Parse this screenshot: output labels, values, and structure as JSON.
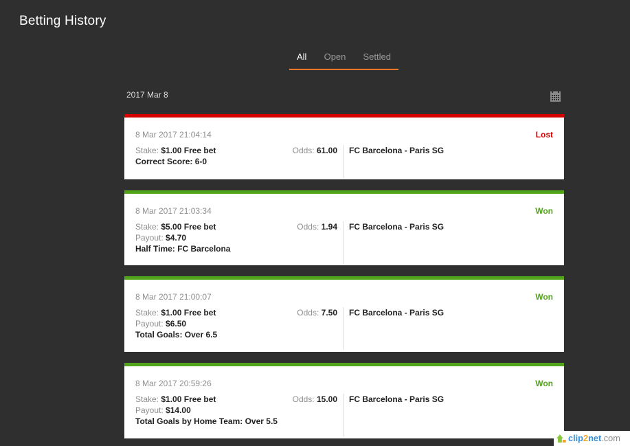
{
  "page": {
    "title": "Betting History"
  },
  "tabs": [
    {
      "label": "All",
      "active": true
    },
    {
      "label": "Open",
      "active": false
    },
    {
      "label": "Settled",
      "active": false
    }
  ],
  "date_group": {
    "label": "2017 Mar 8"
  },
  "labels": {
    "stake": "Stake:",
    "odds": "Odds:",
    "payout": "Payout:"
  },
  "bets": [
    {
      "time": "8 Mar 2017 21:04:14",
      "result": "Lost",
      "stake": "$1.00 Free bet",
      "odds": "61.00",
      "selection": "Correct Score: 6-0",
      "event": "FC Barcelona - Paris SG"
    },
    {
      "time": "8 Mar 2017 21:03:34",
      "result": "Won",
      "stake": "$5.00 Free bet",
      "odds": "1.94",
      "payout": "$4.70",
      "selection": "Half Time: FC Barcelona",
      "event": "FC Barcelona - Paris SG"
    },
    {
      "time": "8 Mar 2017 21:00:07",
      "result": "Won",
      "stake": "$1.00 Free bet",
      "odds": "7.50",
      "payout": "$6.50",
      "selection": "Total Goals: Over 6.5",
      "event": "FC Barcelona - Paris SG"
    },
    {
      "time": "8 Mar 2017 20:59:26",
      "result": "Won",
      "stake": "$1.00 Free bet",
      "odds": "15.00",
      "payout": "$14.00",
      "selection": "Total Goals by Home Team: Over 5.5",
      "event": "FC Barcelona - Paris SG"
    }
  ],
  "colors": {
    "background": "#2f2f2f",
    "accent": "#f07a2a",
    "lost": "#d40000",
    "won": "#52a51a"
  },
  "icons": {
    "calendar": "calendar-icon"
  },
  "watermark": {
    "text": "clip2net.com"
  }
}
